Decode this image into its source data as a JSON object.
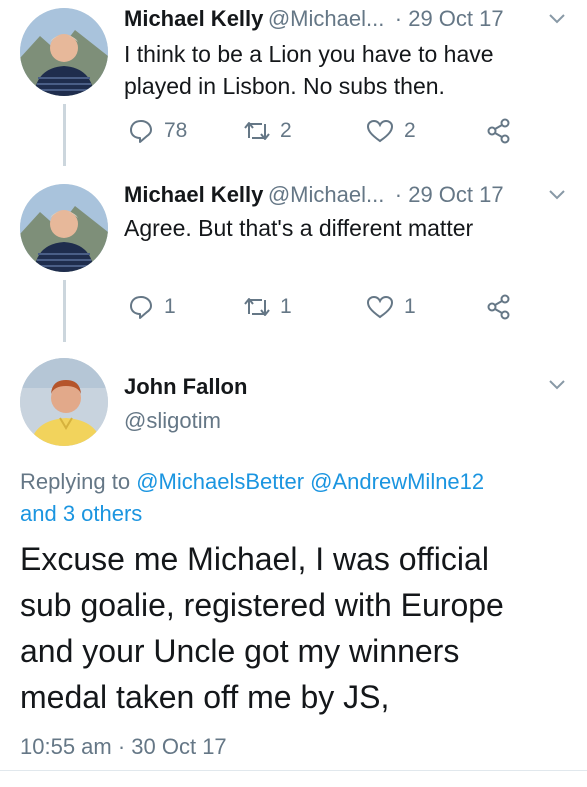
{
  "tweets": [
    {
      "name": "Michael Kelly",
      "handle": "@Michael...",
      "date": "· 29 Oct 17",
      "text_line1": "I think to be a Lion you have to have",
      "text_line2": "played in Lisbon. No subs then.",
      "replies": "78",
      "retweets": "2",
      "likes": "2"
    },
    {
      "name": "Michael Kelly",
      "handle": "@Michael...",
      "date": "· 29 Oct 17",
      "text_line1": "Agree.  But that's a different matter",
      "replies": "1",
      "retweets": "1",
      "likes": "1"
    }
  ],
  "focused": {
    "name": "John Fallon",
    "handle": "@sligotim",
    "replying_prefix": "Replying to",
    "mention1": "@MichaelsBetter",
    "mention2": "@AndrewMilne12",
    "others": "and 3 others",
    "text_line1": "Excuse me Michael, I was official",
    "text_line2": "sub goalie, registered with Europe",
    "text_line3": "and your Uncle got my winners",
    "text_line4": "medal taken off me by JS,",
    "timestamp": "10:55 am · 30 Oct 17"
  },
  "icons": {
    "reply": "reply-icon",
    "retweet": "retweet-icon",
    "like": "heart-icon",
    "share": "share-icon",
    "menu": "chevron-down-icon"
  },
  "colors": {
    "link": "#1b95e0",
    "muted": "#657786",
    "thread_line": "#ccd6dd"
  }
}
